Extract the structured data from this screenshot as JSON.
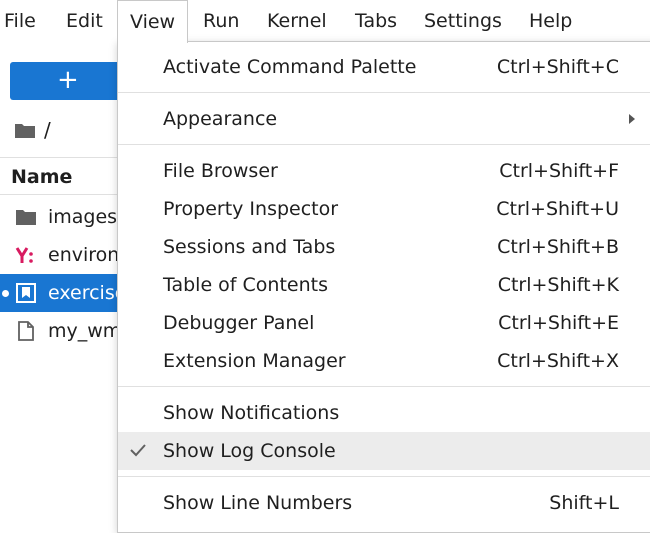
{
  "menubar": {
    "items": [
      "File",
      "Edit",
      "View",
      "Run",
      "Kernel",
      "Tabs",
      "Settings",
      "Help"
    ],
    "active": "View"
  },
  "sidebar": {
    "new_button_label": "+",
    "breadcrumb": "/",
    "column_header": "Name",
    "files": [
      {
        "name": "images",
        "icon": "folder-icon"
      },
      {
        "name": "environ",
        "icon": "yaml-icon"
      },
      {
        "name": "exercise",
        "icon": "notebook-icon",
        "selected": true
      },
      {
        "name": "my_wm",
        "icon": "file-icon"
      }
    ]
  },
  "view_menu": {
    "items": [
      {
        "label": "Activate Command Palette",
        "shortcut": "Ctrl+Shift+C"
      },
      {
        "label": "Appearance",
        "shortcut": ""
      },
      {
        "label": "File Browser",
        "shortcut": "Ctrl+Shift+F"
      },
      {
        "label": "Property Inspector",
        "shortcut": "Ctrl+Shift+U"
      },
      {
        "label": "Sessions and Tabs",
        "shortcut": "Ctrl+Shift+B"
      },
      {
        "label": "Table of Contents",
        "shortcut": "Ctrl+Shift+K"
      },
      {
        "label": "Debugger Panel",
        "shortcut": "Ctrl+Shift+E"
      },
      {
        "label": "Extension Manager",
        "shortcut": "Ctrl+Shift+X"
      },
      {
        "label": "Show Notifications",
        "shortcut": ""
      },
      {
        "label": "Show Log Console",
        "shortcut": "",
        "checked": true
      },
      {
        "label": "Show Line Numbers",
        "shortcut": "Shift+L"
      }
    ]
  },
  "colors": {
    "accent": "#1976d2",
    "yaml_icon": "#d81b60",
    "hover": "#ececec"
  }
}
